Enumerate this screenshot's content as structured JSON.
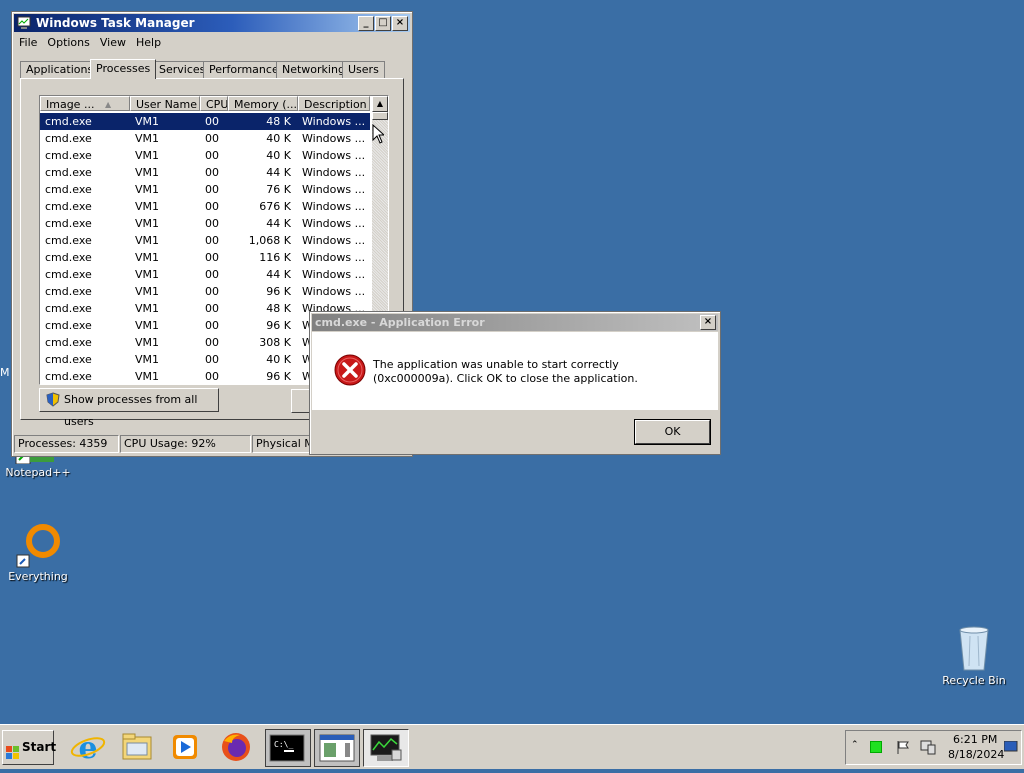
{
  "desktop": {
    "icons": [
      {
        "label": "Notepad++",
        "icon": "notepad-plus-plus-icon"
      },
      {
        "label": "Everything",
        "icon": "everything-search-icon"
      },
      {
        "label": "Recycle Bin",
        "icon": "recycle-bin-icon"
      }
    ],
    "edge_glyph": "M"
  },
  "task_manager": {
    "title": "Windows Task Manager",
    "menu": [
      "File",
      "Options",
      "View",
      "Help"
    ],
    "tabs": [
      "Applications",
      "Processes",
      "Services",
      "Performance",
      "Networking",
      "Users"
    ],
    "active_tab": "Processes",
    "columns": [
      "Image ...",
      "User Name",
      "CPU",
      "Memory (...",
      "Description"
    ],
    "rows": [
      [
        "cmd.exe",
        "VM1",
        "00",
        "48 K",
        "Windows ..."
      ],
      [
        "cmd.exe",
        "VM1",
        "00",
        "40 K",
        "Windows ..."
      ],
      [
        "cmd.exe",
        "VM1",
        "00",
        "40 K",
        "Windows ..."
      ],
      [
        "cmd.exe",
        "VM1",
        "00",
        "44 K",
        "Windows ..."
      ],
      [
        "cmd.exe",
        "VM1",
        "00",
        "76 K",
        "Windows ..."
      ],
      [
        "cmd.exe",
        "VM1",
        "00",
        "676 K",
        "Windows ..."
      ],
      [
        "cmd.exe",
        "VM1",
        "00",
        "44 K",
        "Windows ..."
      ],
      [
        "cmd.exe",
        "VM1",
        "00",
        "1,068 K",
        "Windows ..."
      ],
      [
        "cmd.exe",
        "VM1",
        "00",
        "116 K",
        "Windows ..."
      ],
      [
        "cmd.exe",
        "VM1",
        "00",
        "44 K",
        "Windows ..."
      ],
      [
        "cmd.exe",
        "VM1",
        "00",
        "96 K",
        "Windows ..."
      ],
      [
        "cmd.exe",
        "VM1",
        "00",
        "48 K",
        "Windows ..."
      ],
      [
        "cmd.exe",
        "VM1",
        "00",
        "96 K",
        "W"
      ],
      [
        "cmd.exe",
        "VM1",
        "00",
        "308 K",
        "W"
      ],
      [
        "cmd.exe",
        "VM1",
        "00",
        "40 K",
        "W"
      ],
      [
        "cmd.exe",
        "VM1",
        "00",
        "96 K",
        "W"
      ]
    ],
    "selected_row": 0,
    "show_all_button": "Show processes from all users",
    "status": {
      "processes": "Processes: 4359",
      "cpu": "CPU Usage: 92%",
      "memory": "Physical Me"
    }
  },
  "error_dialog": {
    "title": "cmd.exe - Application Error",
    "message": "The application was unable to start correctly (0xc000009a). Click OK to close the application.",
    "ok_label": "OK",
    "icon": "error-icon"
  },
  "taskbar": {
    "start_label": "Start",
    "pinned": [
      "internet-explorer-icon",
      "file-explorer-icon",
      "media-player-icon",
      "firefox-icon",
      "command-prompt-icon",
      "window-app-icon",
      "task-manager-icon"
    ],
    "tray": {
      "time": "6:21 PM",
      "date": "8/18/2024"
    }
  }
}
